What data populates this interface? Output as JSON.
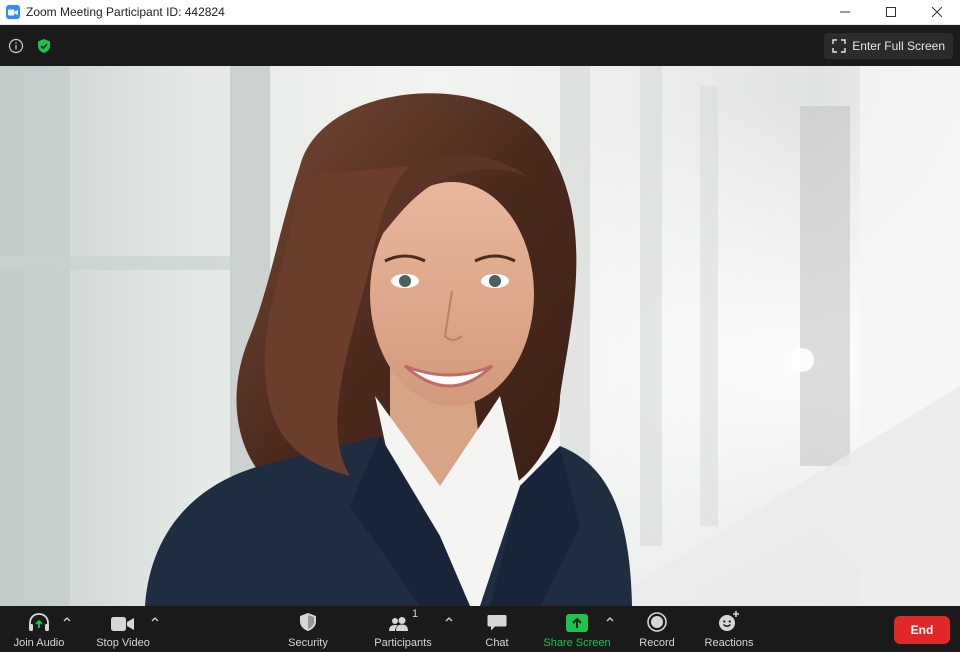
{
  "window": {
    "title": "Zoom Meeting Participant ID: 442824"
  },
  "topbar": {
    "fullscreen_label": "Enter Full Screen"
  },
  "toolbar": {
    "join_audio": "Join Audio",
    "stop_video": "Stop Video",
    "security": "Security",
    "participants": "Participants",
    "participants_count": "1",
    "chat": "Chat",
    "share_screen": "Share Screen",
    "record": "Record",
    "reactions": "Reactions",
    "end": "End"
  },
  "icons": {
    "app": "zoom-logo-icon",
    "info": "info-icon",
    "security": "shield-check-icon",
    "fullscreen": "expand-icon",
    "audio": "headphones-icon",
    "video": "video-camera-icon",
    "participants": "people-icon",
    "chat": "chat-bubble-icon",
    "share": "share-arrow-icon",
    "record": "record-icon",
    "reactions": "emoji-add-icon"
  },
  "colors": {
    "brand": "#2d8cff",
    "accent_green": "#20c14e",
    "end_red": "#e02828",
    "toolbar_bg": "#1a1a1a"
  }
}
